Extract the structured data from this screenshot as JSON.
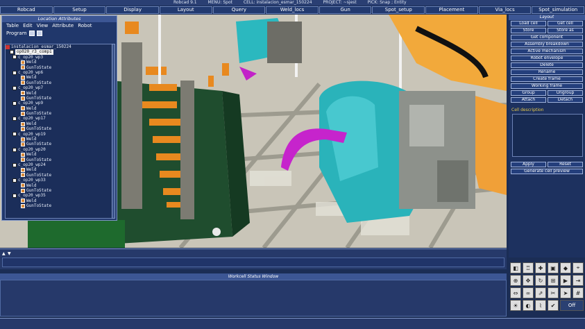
{
  "titlebar": {
    "app": "Robcad 9.1",
    "menu": "MENU: Spot",
    "cell": "CELL: instalacion_esmar_150224",
    "project": "PROJECT: ~sjest",
    "pick": "PICK: Snap ; Entity"
  },
  "menubar": [
    "Robcad",
    "Setup",
    "Display",
    "Layout",
    "Query",
    "Weld_locs",
    "Gun",
    "Spot_setup",
    "Placement",
    "Via_locs",
    "Spot_simulation"
  ],
  "location_panel": {
    "title": "Location Attributes",
    "menu": [
      "Table",
      "Edit",
      "View",
      "Attribute",
      "Robot"
    ],
    "program_label": "Program",
    "tree": [
      {
        "text": "instalacion_esmar_150224",
        "kind": "root"
      },
      {
        "text": "op020_r3_comp1",
        "kind": "selected"
      },
      {
        "text": "c_op20_wp3",
        "kind": "loc"
      },
      {
        "text": "Weld",
        "kind": "leaf"
      },
      {
        "text": "GunToState",
        "kind": "leaf"
      },
      {
        "text": "c_op20_wp6",
        "kind": "loc"
      },
      {
        "text": "Weld",
        "kind": "leaf"
      },
      {
        "text": "GunToState",
        "kind": "leaf"
      },
      {
        "text": "c_op20_wp7",
        "kind": "loc"
      },
      {
        "text": "Weld",
        "kind": "leaf"
      },
      {
        "text": "GunToState",
        "kind": "leaf"
      },
      {
        "text": "c_op20_wp9",
        "kind": "loc"
      },
      {
        "text": "Weld",
        "kind": "leaf"
      },
      {
        "text": "GunToState",
        "kind": "leaf"
      },
      {
        "text": "c_op20_wp17",
        "kind": "loc"
      },
      {
        "text": "Weld",
        "kind": "leaf"
      },
      {
        "text": "GunToState",
        "kind": "leaf"
      },
      {
        "text": "c_op20_wp19",
        "kind": "loc"
      },
      {
        "text": "Weld",
        "kind": "leaf"
      },
      {
        "text": "GunToState",
        "kind": "leaf"
      },
      {
        "text": "c_op20_wp20",
        "kind": "loc"
      },
      {
        "text": "Weld",
        "kind": "leaf"
      },
      {
        "text": "GunToState",
        "kind": "leaf"
      },
      {
        "text": "c_op20_wp24",
        "kind": "loc"
      },
      {
        "text": "Weld",
        "kind": "leaf"
      },
      {
        "text": "GunToState",
        "kind": "leaf"
      },
      {
        "text": "c_op20_wp33",
        "kind": "loc"
      },
      {
        "text": "Weld",
        "kind": "leaf"
      },
      {
        "text": "GunToState",
        "kind": "leaf"
      },
      {
        "text": "c_op20_wp35",
        "kind": "loc"
      },
      {
        "text": "Weld",
        "kind": "leaf"
      },
      {
        "text": "GunToState",
        "kind": "leaf"
      }
    ]
  },
  "layout_panel": {
    "title": "Layout",
    "rows": [
      [
        "Load cell",
        "Get cell"
      ],
      [
        "Store",
        "Store as"
      ],
      [
        "Get component"
      ],
      [
        "Assembly breakdown"
      ],
      [
        "Active mechanism"
      ],
      [
        "Robot envelope"
      ],
      [
        "Delete"
      ],
      [
        "Rename"
      ],
      [
        "Create frame"
      ],
      [
        "Working frame"
      ],
      [
        "Group",
        "Ungroup"
      ],
      [
        "Attach",
        "Detach"
      ]
    ],
    "cell_description_label": "Cell description",
    "bottom_rows": [
      [
        "Apply",
        "Reset"
      ],
      [
        "Generate cell preview"
      ]
    ]
  },
  "status_window": {
    "title": "Workcell Status Window"
  },
  "icon_toolbar": {
    "icons": [
      "shaded-view-icon",
      "robot-icon",
      "gun-icon",
      "fixture-icon",
      "part-icon",
      "camera-icon",
      "zoom-icon",
      "pan-icon",
      "rotate-icon",
      "frame-icon",
      "play-icon",
      "step-icon",
      "measure-icon",
      "link-icon",
      "path-icon",
      "cut-icon",
      "arrow-icon",
      "grid-icon",
      "light-icon",
      "palette-icon",
      "wire-icon",
      "check-icon",
      "off-toggle-icon"
    ],
    "off_label": "Off"
  }
}
